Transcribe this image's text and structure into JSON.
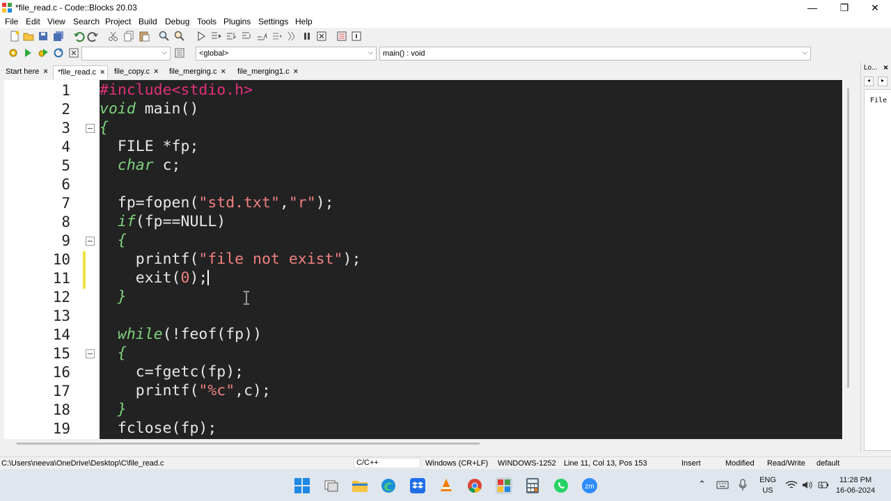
{
  "window": {
    "title": "*file_read.c - Code::Blocks 20.03",
    "minimize": "—",
    "maximize": "❐",
    "close": "✕"
  },
  "menu": [
    "File",
    "Edit",
    "View",
    "Search",
    "Project",
    "Build",
    "Debug",
    "Tools",
    "Plugins",
    "Settings",
    "Help"
  ],
  "toolbar2": {
    "scope": "<global>",
    "function": "main() : void"
  },
  "tabs": [
    {
      "label": "Start here",
      "active": false
    },
    {
      "label": "*file_read.c",
      "active": true
    },
    {
      "label": "file_copy.c",
      "active": false
    },
    {
      "label": "file_merging.c",
      "active": false
    },
    {
      "label": "file_merging1.c",
      "active": false
    }
  ],
  "tab_close": "×",
  "editor": {
    "line_numbers": [
      "1",
      "2",
      "3",
      "4",
      "5",
      "6",
      "7",
      "8",
      "9",
      "10",
      "11",
      "12",
      "13",
      "14",
      "15",
      "16",
      "17",
      "18",
      "19"
    ],
    "code": {
      "l1": "#include<stdio.h>",
      "l2_kw": "void",
      "l2_rest": " main()",
      "l3": "{",
      "l4": "  FILE *fp;",
      "l5_kw": "char",
      "l5_rest": " c;",
      "l7_a": "  fp=fopen(",
      "l7_s1": "\"std.txt\"",
      "l7_b": ",",
      "l7_s2": "\"r\"",
      "l7_c": ");",
      "l8_kw": "if",
      "l8_rest": "(fp==NULL)",
      "l9": "  {",
      "l10_a": "    printf(",
      "l10_s": "\"file not exist\"",
      "l10_b": ");",
      "l11_a": "    exit(",
      "l11_n": "0",
      "l11_b": ");",
      "l12": "  }",
      "l14_kw": "while",
      "l14_rest": "(!feof(fp))",
      "l15": "  {",
      "l16": "    c=fgetc(fp);",
      "l17_a": "    printf(",
      "l17_s": "\"%c\"",
      "l17_b": ",c);",
      "l18": "  }",
      "l19": "  fclose(fp);"
    }
  },
  "right_panel": {
    "title": "Lo...",
    "close": "×",
    "item": "File"
  },
  "status": {
    "path": "C:\\Users\\neeva\\OneDrive\\Desktop\\C\\file_read.c",
    "language": "C/C++",
    "eol": "Windows (CR+LF)",
    "encoding": "WINDOWS-1252",
    "position": "Line 11, Col 13, Pos 153",
    "mode": "Insert",
    "modified": "Modified",
    "access": "Read/Write",
    "profile": "default"
  },
  "taskbar": {
    "lang_top": "ENG",
    "lang_bottom": "US",
    "time": "11:28 PM",
    "date": "16-06-2024",
    "chevron": "⌃"
  },
  "colors": {
    "code_bg": "#222222",
    "keyword": "#7fd37f",
    "preprocessor": "#e0307a",
    "string": "#f08080"
  }
}
